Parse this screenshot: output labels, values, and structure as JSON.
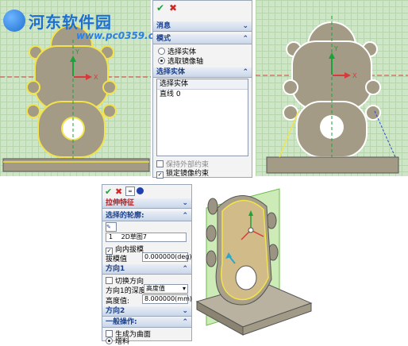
{
  "watermark": {
    "title": "河东软件园",
    "url": "www.pc0359.cn"
  },
  "sketch_panel": {
    "confirm_icon": "checkmark-icon",
    "cancel_icon": "close-icon",
    "sections": {
      "message": "消息",
      "mode": "模式",
      "select_entity": "选择实体"
    },
    "mode_options": [
      "选择实体",
      "选取镜像轴"
    ],
    "mode_selected_index": 1,
    "list_header": "选择实体",
    "list_items": [
      "直线 0"
    ],
    "keep_external_constraints": "保持外部约束",
    "lock_mirror_constraint": "锁定镜像约束"
  },
  "canvas_left": {
    "axis_x_label": "X",
    "axis_y_label": "Y"
  },
  "canvas_right": {
    "axis_x_label": "X",
    "axis_y_label": "Y"
  },
  "extrude_panel": {
    "title": "拉伸特征",
    "sections": {
      "profile": "选择的轮廓:",
      "direction1": "方向1",
      "direction2": "方向2",
      "general": "一般操作:"
    },
    "profile_index": "1",
    "profile_name": "2D草图7",
    "draft_inward": "向内拔模",
    "draft_label": "拔模值",
    "draft_value": "0.000000(deg)",
    "flip_direction": "切换方向",
    "depth_label": "方向1的深度",
    "depth_option": "高度值",
    "height_label": "高度值:",
    "height_value": "8.000000(mm)",
    "generate_surface": "生成为曲面",
    "add_material": "增料"
  }
}
